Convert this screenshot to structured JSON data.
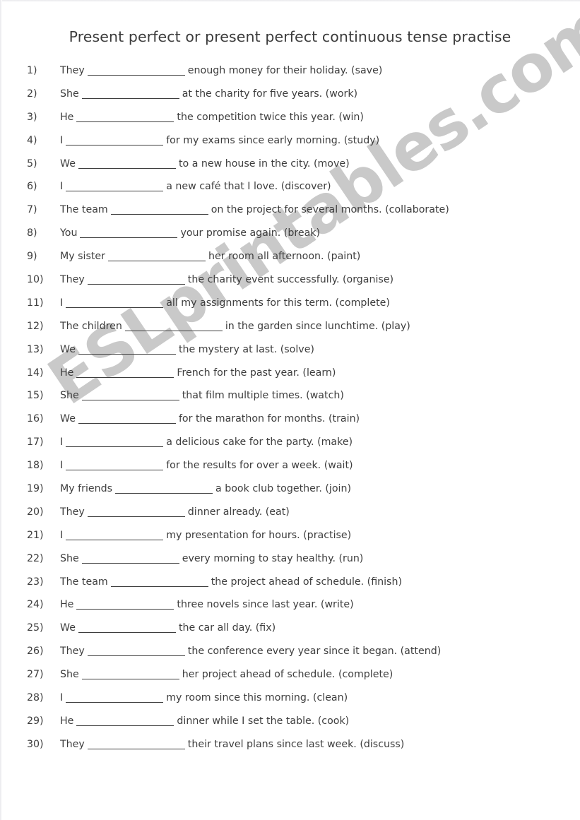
{
  "document": {
    "title": "Present perfect or present perfect continuous tense practise",
    "watermark": "ESLprintables.com",
    "page_background": "#ffffff",
    "text_color": "#3d3d3d",
    "watermark_color": "#c9c9c9",
    "blank_marker": "________________"
  },
  "exercises": [
    {
      "number": "1)",
      "before": "They",
      "after": "enough money for their holiday. (save)"
    },
    {
      "number": "2)",
      "before": "She",
      "after": "at the charity for five years. (work)"
    },
    {
      "number": "3)",
      "before": "He",
      "after": "the competition twice this year. (win)"
    },
    {
      "number": "4)",
      "before": "I",
      "after": "for my exams since early morning. (study)"
    },
    {
      "number": "5)",
      "before": "We",
      "after": "to a new house in the city. (move)"
    },
    {
      "number": "6)",
      "before": "I",
      "after": "a new café that I love. (discover)"
    },
    {
      "number": "7)",
      "before": "The team",
      "after": "on the project for several months. (collaborate)"
    },
    {
      "number": "8)",
      "before": "You",
      "after": "your promise again. (break)"
    },
    {
      "number": "9)",
      "before": "My sister",
      "after": "her room all afternoon. (paint)"
    },
    {
      "number": "10)",
      "before": "They",
      "after": "the charity event successfully. (organise)"
    },
    {
      "number": "11)",
      "before": "I",
      "after": "all my assignments for this term. (complete)"
    },
    {
      "number": "12)",
      "before": "The children",
      "after": "in the garden since lunchtime. (play)"
    },
    {
      "number": "13)",
      "before": "We",
      "after": "the mystery at last. (solve)"
    },
    {
      "number": "14)",
      "before": "He",
      "after": "French for the past year. (learn)"
    },
    {
      "number": "15)",
      "before": "She",
      "after": "that film multiple times. (watch)"
    },
    {
      "number": "16)",
      "before": "We",
      "after": "for the marathon for months. (train)"
    },
    {
      "number": "17)",
      "before": "I",
      "after": "a delicious cake for the party. (make)"
    },
    {
      "number": "18)",
      "before": "I",
      "after": "for the results for over a week. (wait)"
    },
    {
      "number": "19)",
      "before": "My friends",
      "after": "a book club together. (join)"
    },
    {
      "number": "20)",
      "before": "They",
      "after": "dinner already. (eat)"
    },
    {
      "number": "21)",
      "before": "I",
      "after": "my presentation for hours. (practise)"
    },
    {
      "number": "22)",
      "before": "She",
      "after": "every morning to stay healthy. (run)"
    },
    {
      "number": "23)",
      "before": "The team",
      "after": "the project ahead of schedule. (finish)"
    },
    {
      "number": "24)",
      "before": "He",
      "after": "three novels since last year. (write)"
    },
    {
      "number": "25)",
      "before": "We",
      "after": "the car all day. (fix)"
    },
    {
      "number": "26)",
      "before": "They",
      "after": "the conference every year since it began. (attend)"
    },
    {
      "number": "27)",
      "before": "She",
      "after": "her project ahead of schedule. (complete)"
    },
    {
      "number": "28)",
      "before": "I",
      "after": "my room since this morning. (clean)"
    },
    {
      "number": "29)",
      "before": "He",
      "after": "dinner while I set the table. (cook)"
    },
    {
      "number": "30)",
      "before": "They",
      "after": "their travel plans since last week. (discuss)"
    }
  ]
}
